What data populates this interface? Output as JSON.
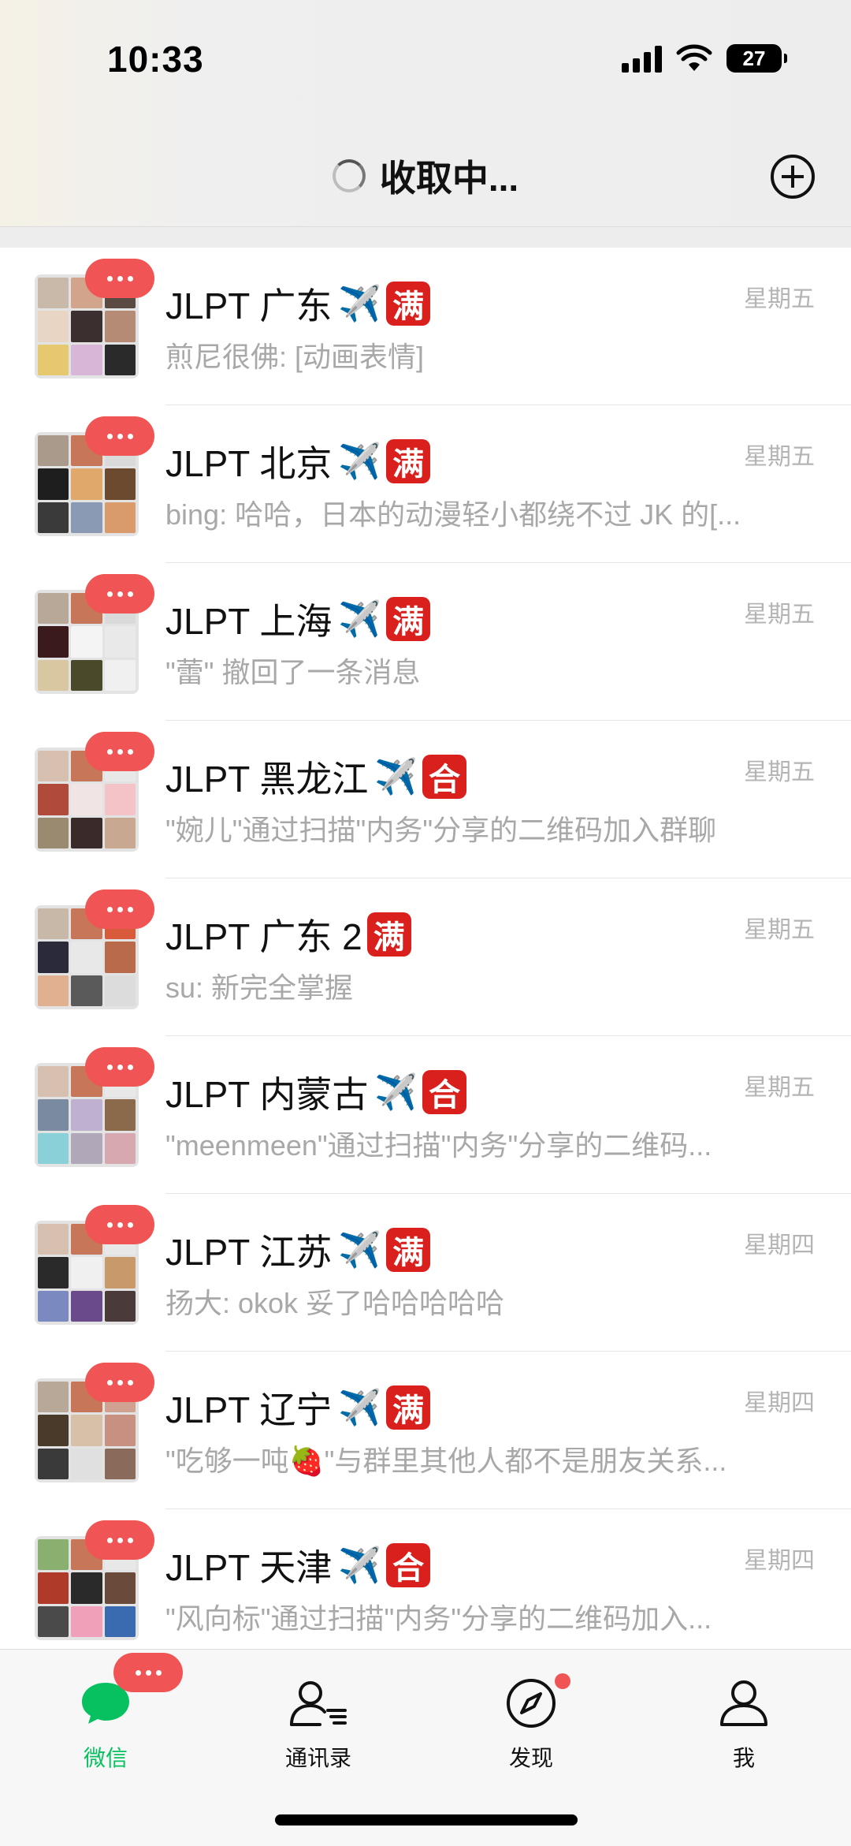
{
  "status_bar": {
    "time": "10:33",
    "battery": "27"
  },
  "nav": {
    "title": "收取中..."
  },
  "chats": [
    {
      "name": "JLPT 广东",
      "plane": "✈️",
      "tag": "满",
      "time": "星期五",
      "preview": "煎尼很佛: [动画表情]"
    },
    {
      "name": "JLPT 北京",
      "plane": "✈️",
      "tag": "满",
      "time": "星期五",
      "preview": "bing: 哈哈，日本的动漫轻小都绕不过 JK 的[..."
    },
    {
      "name": "JLPT 上海",
      "plane": "✈️",
      "tag": "满",
      "time": "星期五",
      "preview": "\"蕾\" 撤回了一条消息"
    },
    {
      "name": "JLPT 黑龙江",
      "plane": "✈️",
      "tag": "合",
      "time": "星期五",
      "preview": "\"婉儿\"通过扫描\"内务\"分享的二维码加入群聊"
    },
    {
      "name": "JLPT 广东 2",
      "plane": "",
      "tag": "满",
      "time": "星期五",
      "preview": "su: 新完全掌握"
    },
    {
      "name": "JLPT 内蒙古",
      "plane": "✈️",
      "tag": "合",
      "time": "星期五",
      "preview": "\"meenmeen\"通过扫描\"内务\"分享的二维码..."
    },
    {
      "name": "JLPT 江苏",
      "plane": "✈️",
      "tag": "满",
      "time": "星期四",
      "preview": "扬大: okok 妥了哈哈哈哈哈"
    },
    {
      "name": "JLPT 辽宁",
      "plane": "✈️",
      "tag": "满",
      "time": "星期四",
      "preview": "\"吃够一吨🍓\"与群里其他人都不是朋友关系..."
    },
    {
      "name": "JLPT 天津",
      "plane": "✈️",
      "tag": "合",
      "time": "星期四",
      "preview": "\"风向标\"通过扫描\"内务\"分享的二维码加入..."
    }
  ],
  "tabs": [
    {
      "label": "微信",
      "icon": "chat-bubble-icon",
      "active": true
    },
    {
      "label": "通讯录",
      "icon": "contacts-icon",
      "active": false
    },
    {
      "label": "发现",
      "icon": "compass-icon",
      "active": false
    },
    {
      "label": "我",
      "icon": "person-icon",
      "active": false
    }
  ],
  "colors": {
    "accent": "#07c160",
    "badge": "#f05454",
    "tag": "#d9201d"
  }
}
